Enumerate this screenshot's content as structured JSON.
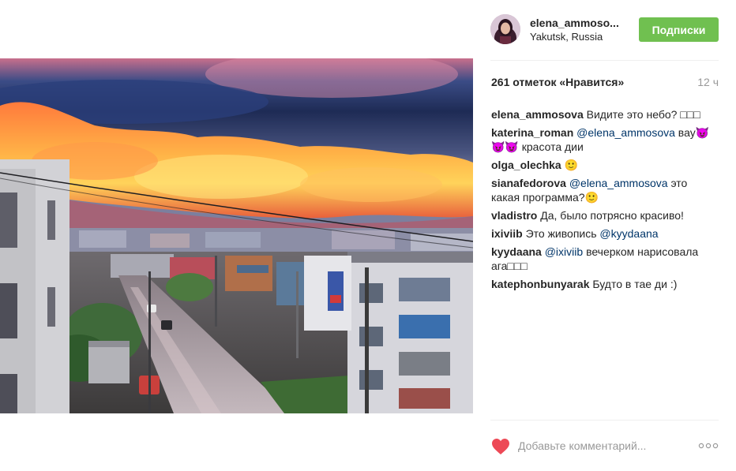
{
  "post": {
    "username": "elena_ammoso...",
    "location": "Yakutsk, Russia",
    "follow_label": "Подписки",
    "likes": "261 отметок «Нравится»",
    "time": "12 ч"
  },
  "comments": [
    {
      "user": "elena_ammosova",
      "mention": "",
      "text": "Видите это небо? □□□"
    },
    {
      "user": "katerina_roman",
      "mention": "@elena_ammosova",
      "text": "вау😈😈😈 красота дии"
    },
    {
      "user": "olga_olechka",
      "mention": "",
      "text": "🙂"
    },
    {
      "user": "sianafedorova",
      "mention": "@elena_ammosova",
      "text": "это какая программа?🙂"
    },
    {
      "user": "vladistro",
      "mention": "",
      "text": "Да, было потрясно красиво!"
    },
    {
      "user": "ixiviib",
      "mention": "",
      "text": "Это живопись",
      "mention_after": "@kyydaana"
    },
    {
      "user": "kyydaana",
      "mention": "@ixiviib",
      "text": "вечерком нарисовала ага□□□"
    },
    {
      "user": "katephonbunyarak",
      "mention": "",
      "text": "Будто в тае ди :)"
    }
  ],
  "comment_box": {
    "placeholder": "Добавьте комментарий..."
  },
  "icons": {
    "like": "heart-icon",
    "more": "more-options-icon"
  },
  "colors": {
    "follow_button": "#70c050",
    "heart": "#ed4956",
    "mention": "#003569"
  }
}
